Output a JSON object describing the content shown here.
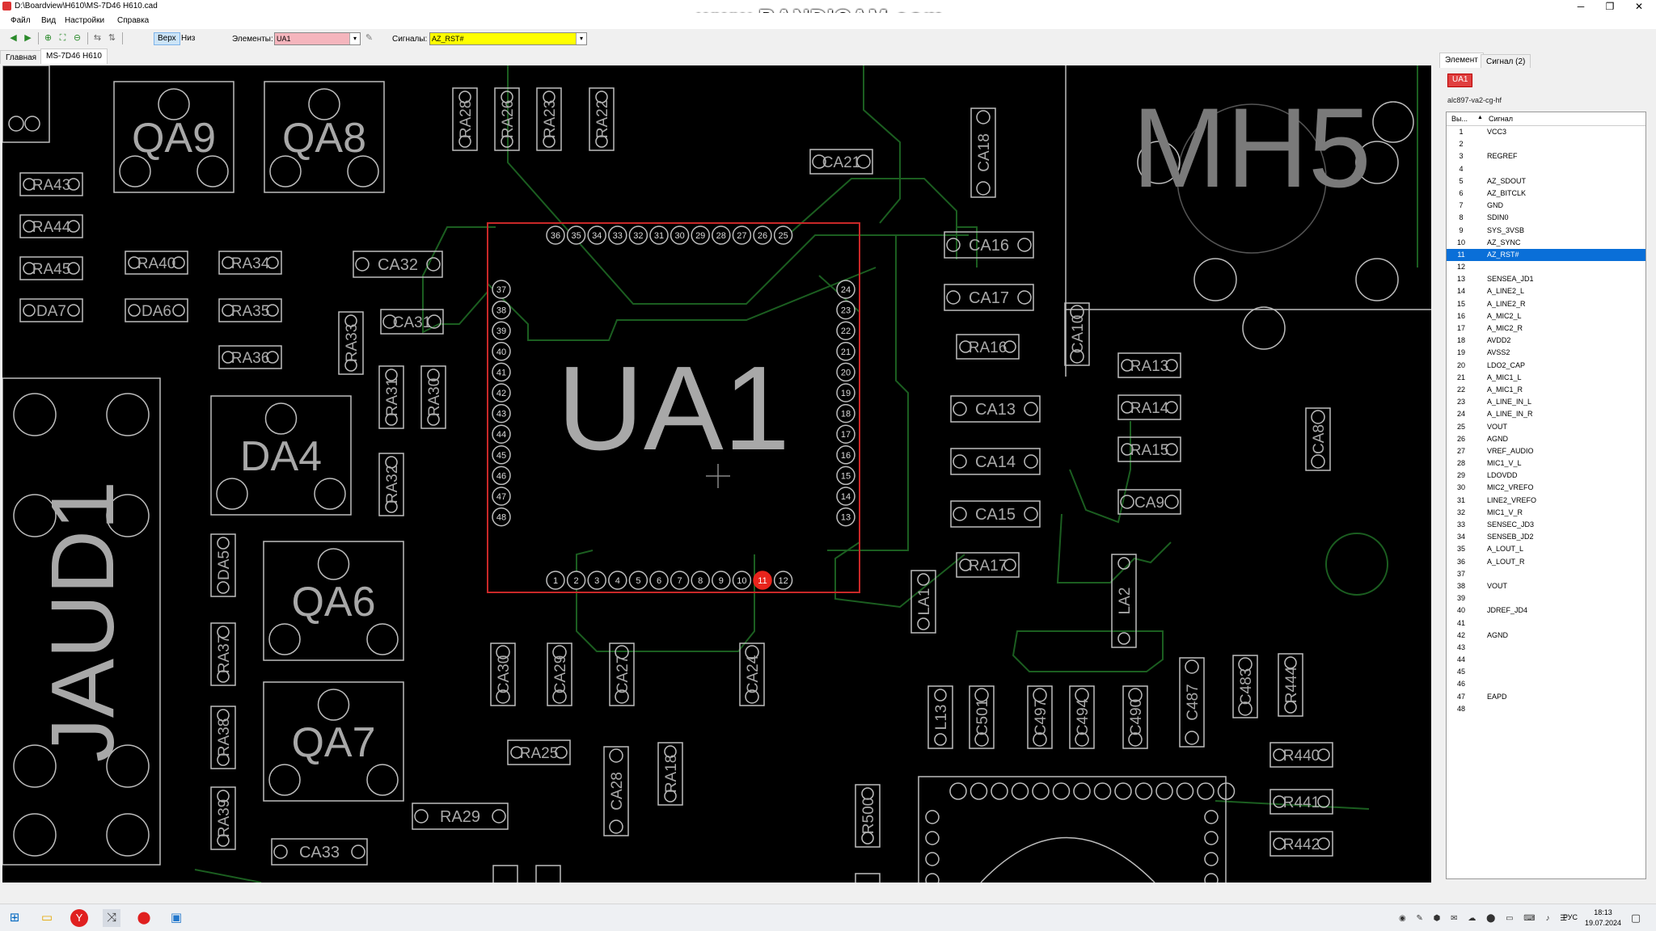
{
  "window": {
    "title": "D:\\Boardview\\H610\\MS-7D46 H610.cad",
    "watermark": "www.BANDICAM.com",
    "minimize": "─",
    "restore": "❐",
    "close": "✕"
  },
  "menu": [
    "Файл",
    "Вид",
    "Настройки",
    "Справка"
  ],
  "toolbar": {
    "top_label": "Верх",
    "bottom_label": "Низ",
    "elements_label": "Элементы:",
    "elements_value": "UA1",
    "signals_label": "Сигналы:",
    "signals_value": "AZ_RST#"
  },
  "tabs": [
    "Главная",
    "MS-7D46 H610"
  ],
  "right_tabs": [
    "Элемент",
    "Сигнал (2)"
  ],
  "element": {
    "name": "UA1",
    "part": "alc897-va2-cg-hf"
  },
  "grid": {
    "col_pin": "Вы...",
    "col_signal": "Сигнал",
    "sort_icon": "▲"
  },
  "pins": [
    {
      "n": "1",
      "s": "VCC3"
    },
    {
      "n": "2",
      "s": ""
    },
    {
      "n": "3",
      "s": "REGREF"
    },
    {
      "n": "4",
      "s": ""
    },
    {
      "n": "5",
      "s": "AZ_SDOUT"
    },
    {
      "n": "6",
      "s": "AZ_BITCLK"
    },
    {
      "n": "7",
      "s": "GND"
    },
    {
      "n": "8",
      "s": "SDIN0"
    },
    {
      "n": "9",
      "s": "SYS_3VSB"
    },
    {
      "n": "10",
      "s": "AZ_SYNC"
    },
    {
      "n": "11",
      "s": "AZ_RST#"
    },
    {
      "n": "12",
      "s": ""
    },
    {
      "n": "13",
      "s": "SENSEA_JD1"
    },
    {
      "n": "14",
      "s": "A_LINE2_L"
    },
    {
      "n": "15",
      "s": "A_LINE2_R"
    },
    {
      "n": "16",
      "s": "A_MIC2_L"
    },
    {
      "n": "17",
      "s": "A_MIC2_R"
    },
    {
      "n": "18",
      "s": "AVDD2"
    },
    {
      "n": "19",
      "s": "AVSS2"
    },
    {
      "n": "20",
      "s": "LDO2_CAP"
    },
    {
      "n": "21",
      "s": "A_MIC1_L"
    },
    {
      "n": "22",
      "s": "A_MIC1_R"
    },
    {
      "n": "23",
      "s": "A_LINE_IN_L"
    },
    {
      "n": "24",
      "s": "A_LINE_IN_R"
    },
    {
      "n": "25",
      "s": "VOUT"
    },
    {
      "n": "26",
      "s": "AGND"
    },
    {
      "n": "27",
      "s": "VREF_AUDIO"
    },
    {
      "n": "28",
      "s": "MIC1_V_L"
    },
    {
      "n": "29",
      "s": "LDOVDD"
    },
    {
      "n": "30",
      "s": "MIC2_VREFO"
    },
    {
      "n": "31",
      "s": "LINE2_VREFO"
    },
    {
      "n": "32",
      "s": "MIC1_V_R"
    },
    {
      "n": "33",
      "s": "SENSEC_JD3"
    },
    {
      "n": "34",
      "s": "SENSEB_JD2"
    },
    {
      "n": "35",
      "s": "A_LOUT_L"
    },
    {
      "n": "36",
      "s": "A_LOUT_R"
    },
    {
      "n": "37",
      "s": ""
    },
    {
      "n": "38",
      "s": "VOUT"
    },
    {
      "n": "39",
      "s": ""
    },
    {
      "n": "40",
      "s": "JDREF_JD4"
    },
    {
      "n": "41",
      "s": ""
    },
    {
      "n": "42",
      "s": "AGND"
    },
    {
      "n": "43",
      "s": ""
    },
    {
      "n": "44",
      "s": ""
    },
    {
      "n": "45",
      "s": ""
    },
    {
      "n": "46",
      "s": ""
    },
    {
      "n": "47",
      "s": "EAPD"
    },
    {
      "n": "48",
      "s": ""
    }
  ],
  "selected_pin": "11",
  "board": {
    "chip_label": "UA1",
    "labels": [
      "QA9",
      "QA8",
      "QA6",
      "QA7",
      "DA4",
      "JAUD1",
      "MH5",
      "RA43",
      "RA44",
      "RA45",
      "DA7",
      "RA40",
      "RA34",
      "DA6",
      "RA35",
      "RA36",
      "CA32",
      "CA31",
      "RA33",
      "RA31",
      "RA30",
      "RA32",
      "DA5",
      "RA37",
      "RA38",
      "RA39",
      "RA28",
      "RA26",
      "RA23",
      "RA22",
      "CA21",
      "CA18",
      "CA16",
      "CA17",
      "RA16",
      "CA10",
      "CA13",
      "CA14",
      "CA15",
      "RA17",
      "RA13",
      "RA14",
      "RA15",
      "CA9",
      "CA8",
      "LA1",
      "LA2",
      "CA30",
      "CA29",
      "CA27",
      "CA24",
      "RA25",
      "CA28",
      "RA18",
      "RA29",
      "CA33",
      "L13",
      "C501",
      "C497",
      "C494",
      "C490",
      "C487",
      "C483",
      "R444",
      "R440",
      "R441",
      "R442",
      "R500"
    ],
    "top_pins": [
      "36",
      "35",
      "34",
      "33",
      "32",
      "31",
      "30",
      "29",
      "28",
      "27",
      "26",
      "25"
    ],
    "left_pins": [
      "37",
      "38",
      "39",
      "40",
      "41",
      "42",
      "43",
      "44",
      "45",
      "46",
      "47",
      "48"
    ],
    "right_pins": [
      "24",
      "23",
      "22",
      "21",
      "20",
      "19",
      "18",
      "17",
      "16",
      "15",
      "14",
      "13"
    ],
    "bottom_pins": [
      "1",
      "2",
      "3",
      "4",
      "5",
      "6",
      "7",
      "8",
      "9",
      "10",
      "11",
      "12"
    ]
  },
  "taskbar": {
    "tray": "◉ ✎ ⬢ ✉ ☁ ⬤ ▭ ⌨ ♪ ☰",
    "lang": "РУС",
    "time": "18:13",
    "date": "19.07.2024"
  },
  "colors": {
    "selected": "#0a6fd8",
    "pin_highlight": "#e8241c",
    "trace": "#1b5e20",
    "outline": "#bdbdbd",
    "element_combo": "#f5b5bd",
    "signal_combo": "#ffff00"
  }
}
